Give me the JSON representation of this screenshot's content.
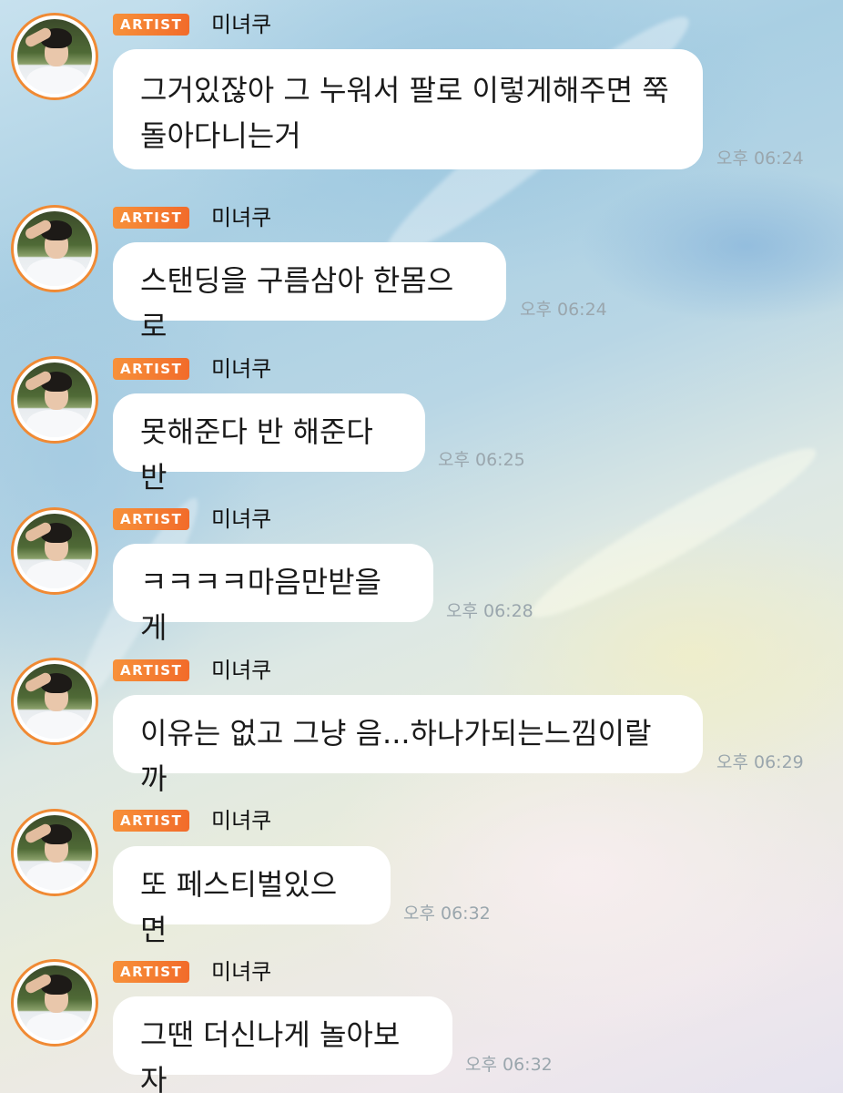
{
  "messages": [
    {
      "badge": "ARTIST",
      "sender": "미녀쿠",
      "text": "그거있잖아 그 누워서 팔로 이렇게해주면 쭉\n돌아다니는거",
      "time": "오후 06:24"
    },
    {
      "badge": "ARTIST",
      "sender": "미녀쿠",
      "text": "스탠딩을 구름삼아 한몸으로",
      "time": "오후 06:24"
    },
    {
      "badge": "ARTIST",
      "sender": "미녀쿠",
      "text": "못해준다 반 해준다반",
      "time": "오후 06:25"
    },
    {
      "badge": "ARTIST",
      "sender": "미녀쿠",
      "text": "ㅋㅋㅋㅋ마음만받을게",
      "time": "오후 06:28"
    },
    {
      "badge": "ARTIST",
      "sender": "미녀쿠",
      "text": "이유는 없고 그냥 음...하나가되는느낌이랄까",
      "time": "오후 06:29"
    },
    {
      "badge": "ARTIST",
      "sender": "미녀쿠",
      "text": "또 페스티벌있으면",
      "time": "오후 06:32"
    },
    {
      "badge": "ARTIST",
      "sender": "미녀쿠",
      "text": "그땐 더신나게 놀아보자",
      "time": "오후 06:32"
    }
  ],
  "colors": {
    "badge": "#f47e32",
    "avatar_ring": "#f08a34",
    "bubble": "#ffffff",
    "timestamp": "#9aa6ad"
  },
  "icons": {
    "avatar": "profile-photo-avatar"
  }
}
